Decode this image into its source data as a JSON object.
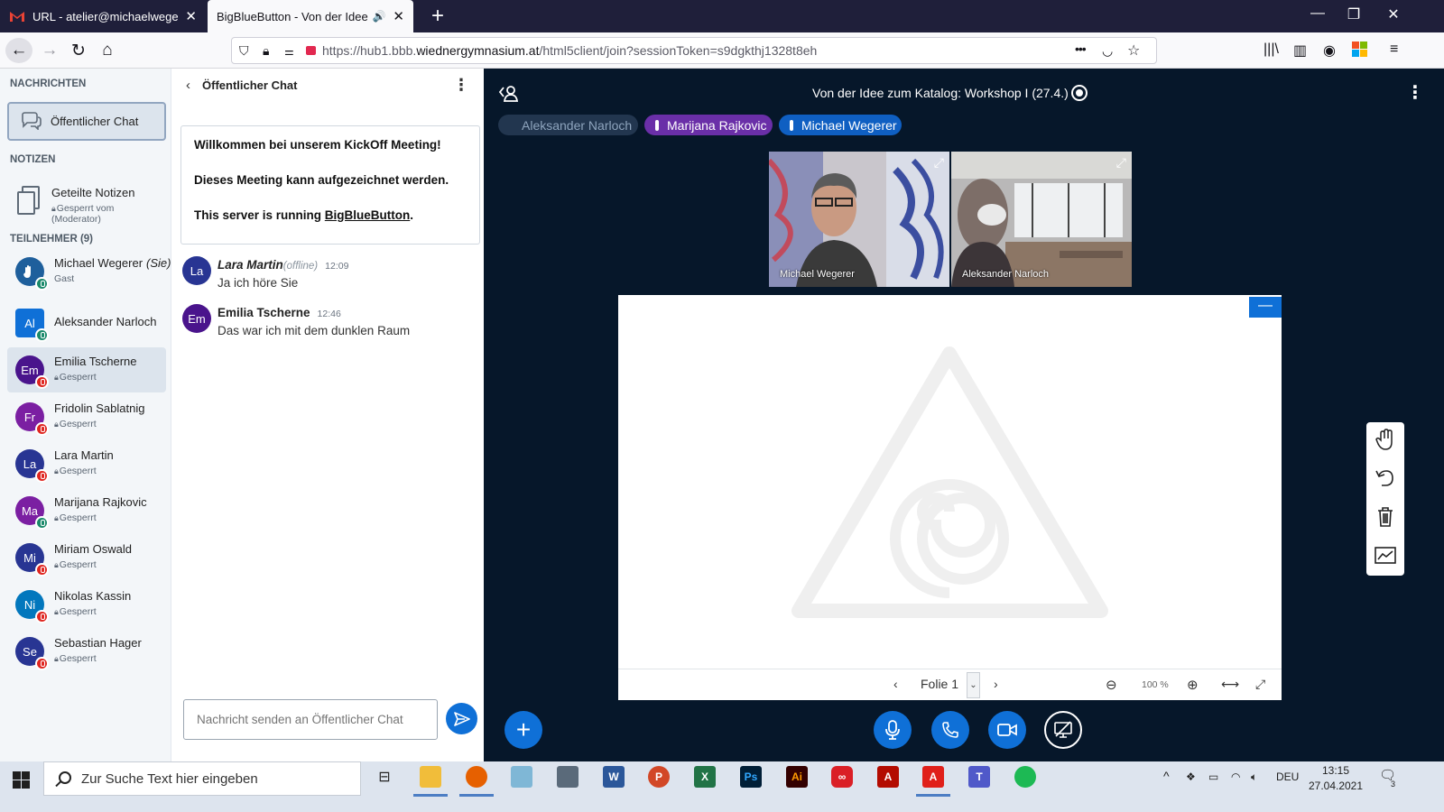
{
  "browser": {
    "tabs": [
      {
        "label": "URL - atelier@michaelwegerer",
        "icon": "gmail-icon"
      },
      {
        "label": "BigBlueButton - Von der Idee zu",
        "icon": "speaker-icon"
      }
    ],
    "new_tab": "+",
    "url": {
      "prefix": "https://hub1.bbb.",
      "domain": "wiednergymnasium.at",
      "path": "/html5client/join?sessionToken=s9dgkthj1328t8eh"
    },
    "more": "•••",
    "window_controls": [
      "—",
      "❐",
      "✕"
    ]
  },
  "userlist": {
    "messages_title": "NACHRICHTEN",
    "public_chat_label": "Öffentlicher Chat",
    "notes_title": "NOTIZEN",
    "shared_notes_label": "Geteilte Notizen",
    "shared_notes_sub": "Gesperrt vom (Moderator)",
    "participants_title": "TEILNEHMER (9)",
    "users": [
      {
        "initials": "",
        "name": "Michael Wegerer",
        "you": "(Sie)",
        "sub": "Gast",
        "color": "#1e5f9c",
        "badge": "mic",
        "avatar_shape": "round"
      },
      {
        "initials": "Al",
        "name": "Aleksander Narloch",
        "you": "",
        "sub": "",
        "color": "#0f70d7",
        "badge": "mic",
        "avatar_shape": "square"
      },
      {
        "initials": "Em",
        "name": "Emilia Tscherne",
        "you": "",
        "sub": "Gesperrt",
        "color": "#4a148c",
        "badge": "lock",
        "avatar_shape": "round"
      },
      {
        "initials": "Fr",
        "name": "Fridolin Sablatnig",
        "you": "",
        "sub": "Gesperrt",
        "color": "#7b1fa2",
        "badge": "lock",
        "avatar_shape": "round"
      },
      {
        "initials": "La",
        "name": "Lara Martin",
        "you": "",
        "sub": "Gesperrt",
        "color": "#283593",
        "badge": "lock",
        "avatar_shape": "round"
      },
      {
        "initials": "Ma",
        "name": "Marijana Rajkovic",
        "you": "",
        "sub": "Gesperrt",
        "color": "#7b1fa2",
        "badge": "mic",
        "avatar_shape": "round"
      },
      {
        "initials": "Mi",
        "name": "Miriam Oswald",
        "you": "",
        "sub": "Gesperrt",
        "color": "#283593",
        "badge": "lock",
        "avatar_shape": "round"
      },
      {
        "initials": "Ni",
        "name": "Nikolas Kassin",
        "you": "",
        "sub": "Gesperrt",
        "color": "#0277bd",
        "badge": "lock",
        "avatar_shape": "round"
      },
      {
        "initials": "Se",
        "name": "Sebastian Hager",
        "you": "",
        "sub": "Gesperrt",
        "color": "#283593",
        "badge": "lock",
        "avatar_shape": "round"
      }
    ]
  },
  "chat": {
    "back": "‹",
    "title": "Öffentlicher Chat",
    "welcome": {
      "line1": "Willkommen bei unserem KickOff Meeting!",
      "line2": "Dieses Meeting kann aufgezeichnet werden.",
      "line3_prefix": "This server is running ",
      "line3_link": "BigBlueButton",
      "line3_suffix": "."
    },
    "messages": [
      {
        "initials": "La",
        "name": "Lara Martin",
        "status": "(offline)",
        "time": "12:09",
        "text": "Ja ich höre Sie",
        "color": "#283593"
      },
      {
        "initials": "Em",
        "name": "Emilia Tscherne",
        "status": "",
        "time": "12:46",
        "text": "Das war ich mit dem dunklen Raum",
        "color": "#4a148c"
      }
    ],
    "input_placeholder": "Nachricht senden an Öffentlicher Chat"
  },
  "main": {
    "meeting_title": "Von der Idee zum Katalog: Workshop I (27.4.)",
    "talkers": [
      {
        "name": "Aleksander Narloch",
        "state": "idle"
      },
      {
        "name": "Marijana Rajkovic",
        "state": "purple"
      },
      {
        "name": "Michael Wegerer",
        "state": "talking"
      }
    ],
    "videos": [
      {
        "name": "Michael Wegerer"
      },
      {
        "name": "Aleksander Narloch"
      }
    ],
    "slide": {
      "label": "Folie 1",
      "zoom": "100 %",
      "min_button": "—"
    },
    "colors": {
      "background": "#06172a",
      "accent": "#0f70d7"
    }
  },
  "taskbar": {
    "search_placeholder": "Zur Suche Text hier eingeben",
    "apps": [
      "task-view",
      "file-explorer",
      "firefox",
      "notepad",
      "calculator",
      "word",
      "powerpoint",
      "excel",
      "photoshop",
      "illustrator",
      "creative-cloud",
      "acrobat",
      "acrobat-reader",
      "teams",
      "spotify"
    ],
    "language": "DEU",
    "time": "13:15",
    "date": "27.04.2021",
    "notifications": "3"
  }
}
